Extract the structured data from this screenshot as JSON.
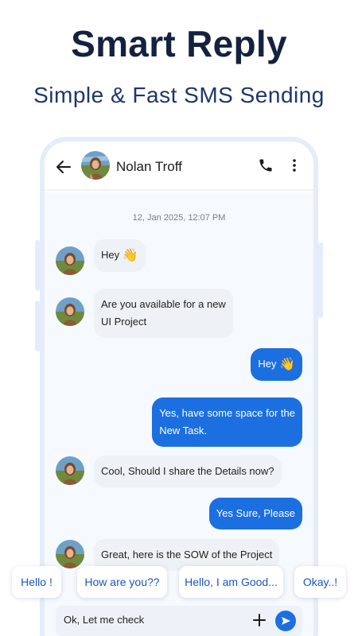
{
  "hero": {
    "title": "Smart Reply",
    "subtitle": "Simple & Fast SMS Sending"
  },
  "header": {
    "contact_name": "Nolan Troff",
    "icons": [
      "back-arrow-icon",
      "contact-avatar",
      "phone-icon",
      "more-vertical-icon"
    ]
  },
  "chat": {
    "timestamp": "12, Jan 2025, 12:07 PM",
    "messages": [
      {
        "direction": "in",
        "text": "Hey",
        "emoji": "👋"
      },
      {
        "direction": "in",
        "line1": "Are you available for a new",
        "line2": "UI Project"
      },
      {
        "direction": "out",
        "text": "Hey",
        "emoji": "👋"
      },
      {
        "direction": "out",
        "line1": "Yes, have some space for the",
        "line2": "New Task."
      },
      {
        "direction": "in",
        "text": "Cool, Should I share the Details now?"
      },
      {
        "direction": "out",
        "text": "Yes Sure, Please"
      },
      {
        "direction": "in",
        "text": "Great, here is the SOW of the Project"
      }
    ]
  },
  "smart_replies": [
    "Hello !",
    "How are you??",
    "Hello, I am Good...",
    "Okay..!"
  ],
  "composer": {
    "value": "Ok, Let me check"
  },
  "colors": {
    "accent": "#1c6fe0",
    "title": "#14223f",
    "chip_text": "#1b55c4",
    "frame": "#e5edfa"
  }
}
